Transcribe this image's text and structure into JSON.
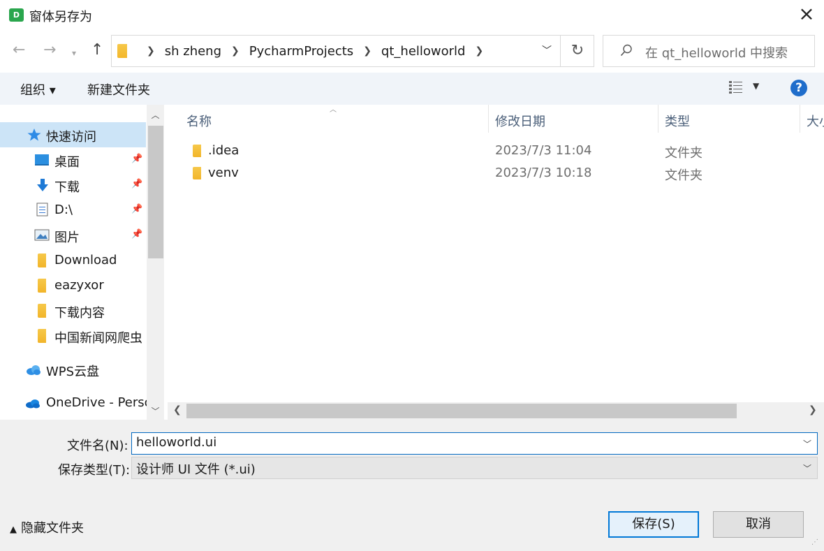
{
  "window": {
    "icon_text": "D",
    "title": "窗体另存为"
  },
  "address": {
    "crumbs": [
      "sh zheng",
      "PycharmProjects",
      "qt_helloworld"
    ]
  },
  "search": {
    "placeholder": "在 qt_helloworld 中搜索"
  },
  "toolbar": {
    "organize": "组织 ▾",
    "new_folder": "新建文件夹",
    "help": "?"
  },
  "nav": {
    "items": [
      {
        "label": "快速访问",
        "icon": "star-icon"
      },
      {
        "label": "桌面",
        "icon": "desktop-icon"
      },
      {
        "label": "下载",
        "icon": "download-arrow-icon"
      },
      {
        "label": "D:\\",
        "icon": "document-icon"
      },
      {
        "label": "图片",
        "icon": "picture-icon"
      },
      {
        "label": "Download",
        "icon": "folder-icon"
      },
      {
        "label": "eazyxor",
        "icon": "folder-icon"
      },
      {
        "label": "下载内容",
        "icon": "folder-icon"
      },
      {
        "label": "中国新闻网爬虫",
        "icon": "folder-icon"
      },
      {
        "label": "WPS云盘",
        "icon": "cloud-icon"
      },
      {
        "label": "OneDrive - Perso",
        "icon": "onedrive-icon"
      }
    ]
  },
  "columns": {
    "name": "名称",
    "modified": "修改日期",
    "type": "类型",
    "size": "大小"
  },
  "files": [
    {
      "name": ".idea",
      "modified": "2023/7/3 11:04",
      "type": "文件夹"
    },
    {
      "name": "venv",
      "modified": "2023/7/3 10:18",
      "type": "文件夹"
    }
  ],
  "form": {
    "filename_label": "文件名(N):",
    "filename_value": "helloworld.ui",
    "filetype_label": "保存类型(T):",
    "filetype_value": "设计师 UI 文件 (*.ui)"
  },
  "footer": {
    "hide_folders": "隐藏文件夹",
    "save": "保存(S)",
    "cancel": "取消"
  },
  "colors": {
    "accent": "#0078d7",
    "selection": "#cce4f7",
    "folder": "#f3b72a"
  }
}
